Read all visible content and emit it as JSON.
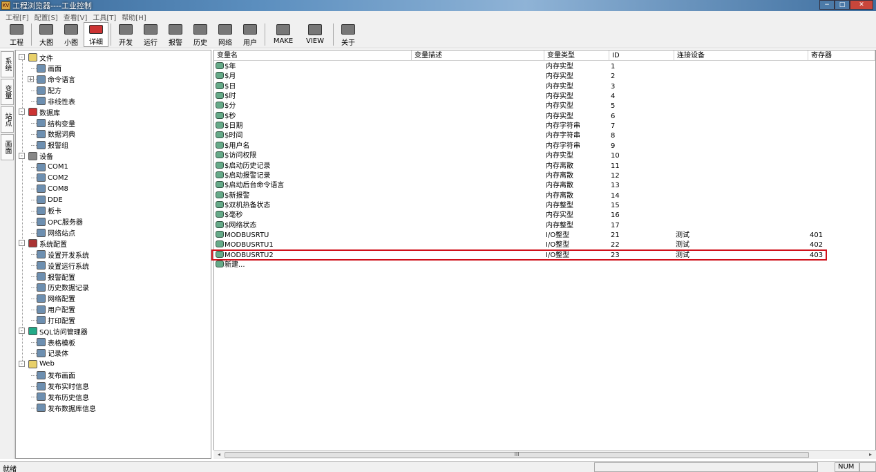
{
  "window": {
    "title": "工程浏览器----工业控制",
    "app_icon_text": "KV"
  },
  "menu": [
    "工程[F]",
    "配置[S]",
    "查看[V]",
    "工具[T]",
    "帮助[H]"
  ],
  "toolbar": [
    "工程",
    "大图",
    "小图",
    "详细",
    "开发",
    "运行",
    "报警",
    "历史",
    "网络",
    "用户",
    "MAKE",
    "VIEW",
    "关于"
  ],
  "side_tabs": [
    "系统",
    "变量",
    "站点",
    "画面"
  ],
  "tree": [
    {
      "label": "文件",
      "level": 0,
      "icon": "folder-icon",
      "exp": "-"
    },
    {
      "label": "画面",
      "level": 1,
      "icon": "screen-icon"
    },
    {
      "label": "命令语言",
      "level": 1,
      "icon": "script-icon",
      "exp": "+"
    },
    {
      "label": "配方",
      "level": 1,
      "icon": "recipe-icon"
    },
    {
      "label": "非线性表",
      "level": 1,
      "icon": "table-icon"
    },
    {
      "label": "数据库",
      "level": 0,
      "icon": "database-icon",
      "exp": "-"
    },
    {
      "label": "结构变量",
      "level": 1,
      "icon": "struct-icon"
    },
    {
      "label": "数据词典",
      "level": 1,
      "icon": "dictionary-icon"
    },
    {
      "label": "报警组",
      "level": 1,
      "icon": "alarm-group-icon"
    },
    {
      "label": "设备",
      "level": 0,
      "icon": "device-icon",
      "exp": "-"
    },
    {
      "label": "COM1",
      "level": 1,
      "icon": "com-port-icon"
    },
    {
      "label": "COM2",
      "level": 1,
      "icon": "com-port-icon"
    },
    {
      "label": "COM8",
      "level": 1,
      "icon": "com-port-icon"
    },
    {
      "label": "DDE",
      "level": 1,
      "icon": "dde-icon"
    },
    {
      "label": "板卡",
      "level": 1,
      "icon": "board-card-icon"
    },
    {
      "label": "OPC服务器",
      "level": 1,
      "icon": "opc-server-icon"
    },
    {
      "label": "网络站点",
      "level": 1,
      "icon": "network-node-icon"
    },
    {
      "label": "系统配置",
      "level": 0,
      "icon": "tools-icon",
      "exp": "-"
    },
    {
      "label": "设置开发系统",
      "level": 1,
      "icon": "dev-settings-icon"
    },
    {
      "label": "设置运行系统",
      "level": 1,
      "icon": "run-settings-icon"
    },
    {
      "label": "报警配置",
      "level": 1,
      "icon": "alarm-config-icon"
    },
    {
      "label": "历史数据记录",
      "level": 1,
      "icon": "history-icon"
    },
    {
      "label": "网络配置",
      "level": 1,
      "icon": "network-config-icon"
    },
    {
      "label": "用户配置",
      "level": 1,
      "icon": "user-config-icon"
    },
    {
      "label": "打印配置",
      "level": 1,
      "icon": "print-icon"
    },
    {
      "label": "SQL访问管理器",
      "level": 0,
      "icon": "sql-icon",
      "exp": "-"
    },
    {
      "label": "表格模板",
      "level": 1,
      "icon": "template-icon"
    },
    {
      "label": "记录体",
      "level": 1,
      "icon": "record-icon"
    },
    {
      "label": "Web",
      "level": 0,
      "icon": "folder-icon",
      "exp": "-"
    },
    {
      "label": "发布画面",
      "level": 1,
      "icon": "publish-screen-icon"
    },
    {
      "label": "发布实时信息",
      "level": 1,
      "icon": "doc-icon"
    },
    {
      "label": "发布历史信息",
      "level": 1,
      "icon": "doc-icon"
    },
    {
      "label": "发布数据库信息",
      "level": 1,
      "icon": "publish-db-icon"
    }
  ],
  "columns": [
    "变量名",
    "变量描述",
    "变量类型",
    "ID",
    "连接设备",
    "寄存器"
  ],
  "rows": [
    {
      "name": "$年",
      "desc": "",
      "type": "内存实型",
      "id": "1",
      "device": "",
      "reg": ""
    },
    {
      "name": "$月",
      "desc": "",
      "type": "内存实型",
      "id": "2",
      "device": "",
      "reg": ""
    },
    {
      "name": "$日",
      "desc": "",
      "type": "内存实型",
      "id": "3",
      "device": "",
      "reg": ""
    },
    {
      "name": "$时",
      "desc": "",
      "type": "内存实型",
      "id": "4",
      "device": "",
      "reg": ""
    },
    {
      "name": "$分",
      "desc": "",
      "type": "内存实型",
      "id": "5",
      "device": "",
      "reg": ""
    },
    {
      "name": "$秒",
      "desc": "",
      "type": "内存实型",
      "id": "6",
      "device": "",
      "reg": ""
    },
    {
      "name": "$日期",
      "desc": "",
      "type": "内存字符串",
      "id": "7",
      "device": "",
      "reg": ""
    },
    {
      "name": "$时间",
      "desc": "",
      "type": "内存字符串",
      "id": "8",
      "device": "",
      "reg": ""
    },
    {
      "name": "$用户名",
      "desc": "",
      "type": "内存字符串",
      "id": "9",
      "device": "",
      "reg": ""
    },
    {
      "name": "$访问权限",
      "desc": "",
      "type": "内存实型",
      "id": "10",
      "device": "",
      "reg": ""
    },
    {
      "name": "$启动历史记录",
      "desc": "",
      "type": "内存离散",
      "id": "11",
      "device": "",
      "reg": ""
    },
    {
      "name": "$启动报警记录",
      "desc": "",
      "type": "内存离散",
      "id": "12",
      "device": "",
      "reg": ""
    },
    {
      "name": "$启动后台命令语言",
      "desc": "",
      "type": "内存离散",
      "id": "13",
      "device": "",
      "reg": ""
    },
    {
      "name": "$新报警",
      "desc": "",
      "type": "内存离散",
      "id": "14",
      "device": "",
      "reg": ""
    },
    {
      "name": "$双机热备状态",
      "desc": "",
      "type": "内存整型",
      "id": "15",
      "device": "",
      "reg": ""
    },
    {
      "name": "$毫秒",
      "desc": "",
      "type": "内存实型",
      "id": "16",
      "device": "",
      "reg": ""
    },
    {
      "name": "$网络状态",
      "desc": "",
      "type": "内存整型",
      "id": "17",
      "device": "",
      "reg": ""
    },
    {
      "name": "MODBUSRTU",
      "desc": "",
      "type": "I/O整型",
      "id": "21",
      "device": "测试",
      "reg": "401"
    },
    {
      "name": "MODBUSRTU1",
      "desc": "",
      "type": "I/O整型",
      "id": "22",
      "device": "测试",
      "reg": "402"
    },
    {
      "name": "MODBUSRTU2",
      "desc": "",
      "type": "I/O整型",
      "id": "23",
      "device": "测试",
      "reg": "403"
    },
    {
      "name": "新建...",
      "desc": "",
      "type": "",
      "id": "",
      "device": "",
      "reg": ""
    }
  ],
  "scrollbar": {
    "left_arrow": "◂",
    "right_arrow": "▸",
    "thumb_grip": "III"
  },
  "status": {
    "text": "就绪",
    "num": "NUM"
  },
  "colors": {
    "highlight": "#d0121b",
    "titlebar": "#3a6a9a"
  }
}
